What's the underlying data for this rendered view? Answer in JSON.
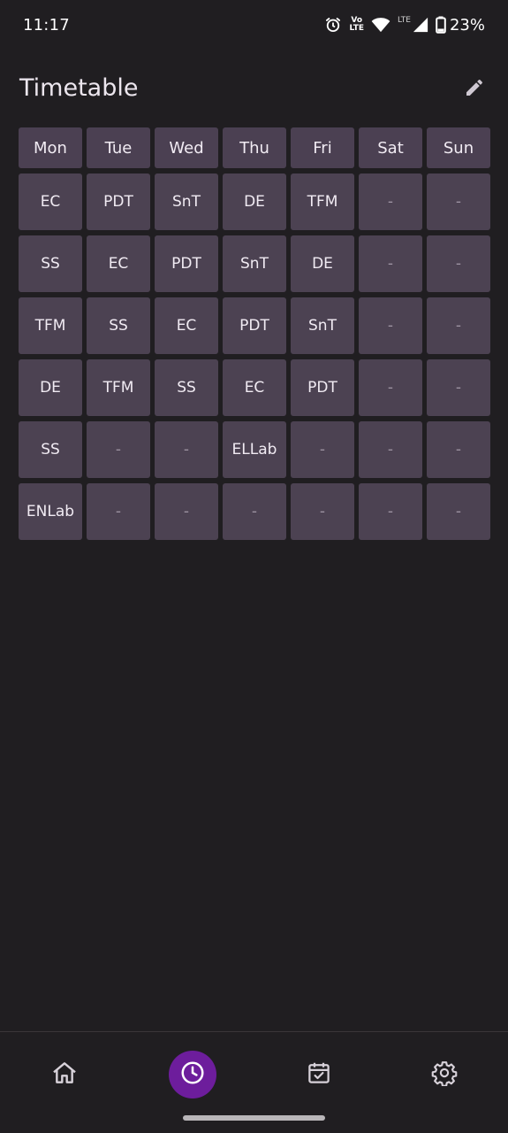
{
  "status_bar": {
    "time": "11:17",
    "volte_top": "Vo",
    "volte_bottom": "LTE",
    "lte_label": "LTE",
    "battery": "23%",
    "icons": [
      "alarm-icon",
      "volte-icon",
      "wifi-icon",
      "signal-icon",
      "battery-icon"
    ]
  },
  "header": {
    "title": "Timetable",
    "edit_icon": "pencil-icon"
  },
  "timetable": {
    "days": [
      "Mon",
      "Tue",
      "Wed",
      "Thu",
      "Fri",
      "Sat",
      "Sun"
    ],
    "rows": [
      [
        "EC",
        "PDT",
        "SnT",
        "DE",
        "TFM",
        "-",
        "-"
      ],
      [
        "SS",
        "EC",
        "PDT",
        "SnT",
        "DE",
        "-",
        "-"
      ],
      [
        "TFM",
        "SS",
        "EC",
        "PDT",
        "SnT",
        "-",
        "-"
      ],
      [
        "DE",
        "TFM",
        "SS",
        "EC",
        "PDT",
        "-",
        "-"
      ],
      [
        "SS",
        "-",
        "-",
        "ELLab",
        "-",
        "-",
        "-"
      ],
      [
        "ENLab",
        "-",
        "-",
        "-",
        "-",
        "-",
        "-"
      ]
    ]
  },
  "bottom_nav": {
    "items": [
      {
        "name": "home",
        "icon": "home-icon",
        "active": false
      },
      {
        "name": "timetable",
        "icon": "clock-icon",
        "active": true
      },
      {
        "name": "calendar",
        "icon": "calendar-check-icon",
        "active": false
      },
      {
        "name": "settings",
        "icon": "gear-icon",
        "active": false
      }
    ],
    "active_color": "#6d1d9c"
  },
  "colors": {
    "background": "#201e21",
    "cell": "#4c4252",
    "text": "#ece6ee"
  }
}
